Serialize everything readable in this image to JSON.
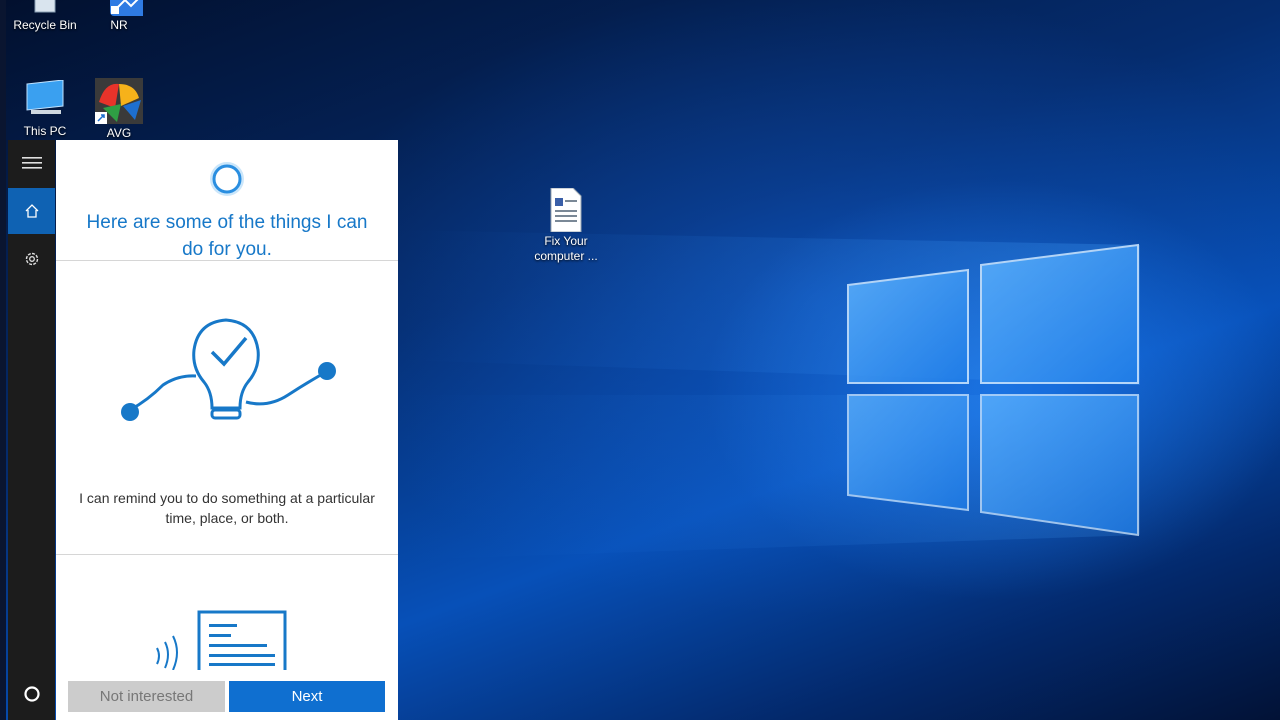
{
  "desktop": {
    "icons": [
      {
        "label": "Recycle Bin"
      },
      {
        "label": "NR"
      },
      {
        "label": "This PC"
      },
      {
        "label": "AVG"
      },
      {
        "label": "Fix Your computer ..."
      }
    ],
    "accent_color": "#0f6fd0"
  },
  "cortana": {
    "rail": {
      "items": [
        "hamburger-menu-icon",
        "home-icon",
        "gear-icon",
        "cortana-circle-icon"
      ]
    },
    "title": "Here are some of the things I can do for you.",
    "reminder_text": "I can remind you to do something at a particular time, place, or both.",
    "buttons": {
      "not_interested": "Not interested",
      "next": "Next"
    },
    "title_color": "#1778c8"
  }
}
